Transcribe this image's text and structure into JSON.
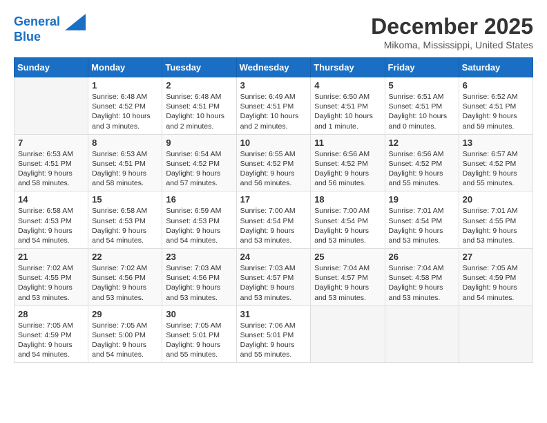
{
  "header": {
    "logo_line1": "General",
    "logo_line2": "Blue",
    "month": "December 2025",
    "location": "Mikoma, Mississippi, United States"
  },
  "weekdays": [
    "Sunday",
    "Monday",
    "Tuesday",
    "Wednesday",
    "Thursday",
    "Friday",
    "Saturday"
  ],
  "weeks": [
    [
      {
        "day": "",
        "empty": true
      },
      {
        "day": "1",
        "sunrise": "6:48 AM",
        "sunset": "4:52 PM",
        "daylight": "10 hours and 3 minutes."
      },
      {
        "day": "2",
        "sunrise": "6:48 AM",
        "sunset": "4:51 PM",
        "daylight": "10 hours and 2 minutes."
      },
      {
        "day": "3",
        "sunrise": "6:49 AM",
        "sunset": "4:51 PM",
        "daylight": "10 hours and 2 minutes."
      },
      {
        "day": "4",
        "sunrise": "6:50 AM",
        "sunset": "4:51 PM",
        "daylight": "10 hours and 1 minute."
      },
      {
        "day": "5",
        "sunrise": "6:51 AM",
        "sunset": "4:51 PM",
        "daylight": "10 hours and 0 minutes."
      },
      {
        "day": "6",
        "sunrise": "6:52 AM",
        "sunset": "4:51 PM",
        "daylight": "9 hours and 59 minutes."
      }
    ],
    [
      {
        "day": "7",
        "sunrise": "6:53 AM",
        "sunset": "4:51 PM",
        "daylight": "9 hours and 58 minutes."
      },
      {
        "day": "8",
        "sunrise": "6:53 AM",
        "sunset": "4:51 PM",
        "daylight": "9 hours and 58 minutes."
      },
      {
        "day": "9",
        "sunrise": "6:54 AM",
        "sunset": "4:52 PM",
        "daylight": "9 hours and 57 minutes."
      },
      {
        "day": "10",
        "sunrise": "6:55 AM",
        "sunset": "4:52 PM",
        "daylight": "9 hours and 56 minutes."
      },
      {
        "day": "11",
        "sunrise": "6:56 AM",
        "sunset": "4:52 PM",
        "daylight": "9 hours and 56 minutes."
      },
      {
        "day": "12",
        "sunrise": "6:56 AM",
        "sunset": "4:52 PM",
        "daylight": "9 hours and 55 minutes."
      },
      {
        "day": "13",
        "sunrise": "6:57 AM",
        "sunset": "4:52 PM",
        "daylight": "9 hours and 55 minutes."
      }
    ],
    [
      {
        "day": "14",
        "sunrise": "6:58 AM",
        "sunset": "4:53 PM",
        "daylight": "9 hours and 54 minutes."
      },
      {
        "day": "15",
        "sunrise": "6:58 AM",
        "sunset": "4:53 PM",
        "daylight": "9 hours and 54 minutes."
      },
      {
        "day": "16",
        "sunrise": "6:59 AM",
        "sunset": "4:53 PM",
        "daylight": "9 hours and 54 minutes."
      },
      {
        "day": "17",
        "sunrise": "7:00 AM",
        "sunset": "4:54 PM",
        "daylight": "9 hours and 53 minutes."
      },
      {
        "day": "18",
        "sunrise": "7:00 AM",
        "sunset": "4:54 PM",
        "daylight": "9 hours and 53 minutes."
      },
      {
        "day": "19",
        "sunrise": "7:01 AM",
        "sunset": "4:54 PM",
        "daylight": "9 hours and 53 minutes."
      },
      {
        "day": "20",
        "sunrise": "7:01 AM",
        "sunset": "4:55 PM",
        "daylight": "9 hours and 53 minutes."
      }
    ],
    [
      {
        "day": "21",
        "sunrise": "7:02 AM",
        "sunset": "4:55 PM",
        "daylight": "9 hours and 53 minutes."
      },
      {
        "day": "22",
        "sunrise": "7:02 AM",
        "sunset": "4:56 PM",
        "daylight": "9 hours and 53 minutes."
      },
      {
        "day": "23",
        "sunrise": "7:03 AM",
        "sunset": "4:56 PM",
        "daylight": "9 hours and 53 minutes."
      },
      {
        "day": "24",
        "sunrise": "7:03 AM",
        "sunset": "4:57 PM",
        "daylight": "9 hours and 53 minutes."
      },
      {
        "day": "25",
        "sunrise": "7:04 AM",
        "sunset": "4:57 PM",
        "daylight": "9 hours and 53 minutes."
      },
      {
        "day": "26",
        "sunrise": "7:04 AM",
        "sunset": "4:58 PM",
        "daylight": "9 hours and 53 minutes."
      },
      {
        "day": "27",
        "sunrise": "7:05 AM",
        "sunset": "4:59 PM",
        "daylight": "9 hours and 54 minutes."
      }
    ],
    [
      {
        "day": "28",
        "sunrise": "7:05 AM",
        "sunset": "4:59 PM",
        "daylight": "9 hours and 54 minutes."
      },
      {
        "day": "29",
        "sunrise": "7:05 AM",
        "sunset": "5:00 PM",
        "daylight": "9 hours and 54 minutes."
      },
      {
        "day": "30",
        "sunrise": "7:05 AM",
        "sunset": "5:01 PM",
        "daylight": "9 hours and 55 minutes."
      },
      {
        "day": "31",
        "sunrise": "7:06 AM",
        "sunset": "5:01 PM",
        "daylight": "9 hours and 55 minutes."
      },
      {
        "day": "",
        "empty": true
      },
      {
        "day": "",
        "empty": true
      },
      {
        "day": "",
        "empty": true
      }
    ]
  ],
  "labels": {
    "sunrise": "Sunrise:",
    "sunset": "Sunset:",
    "daylight": "Daylight:"
  }
}
